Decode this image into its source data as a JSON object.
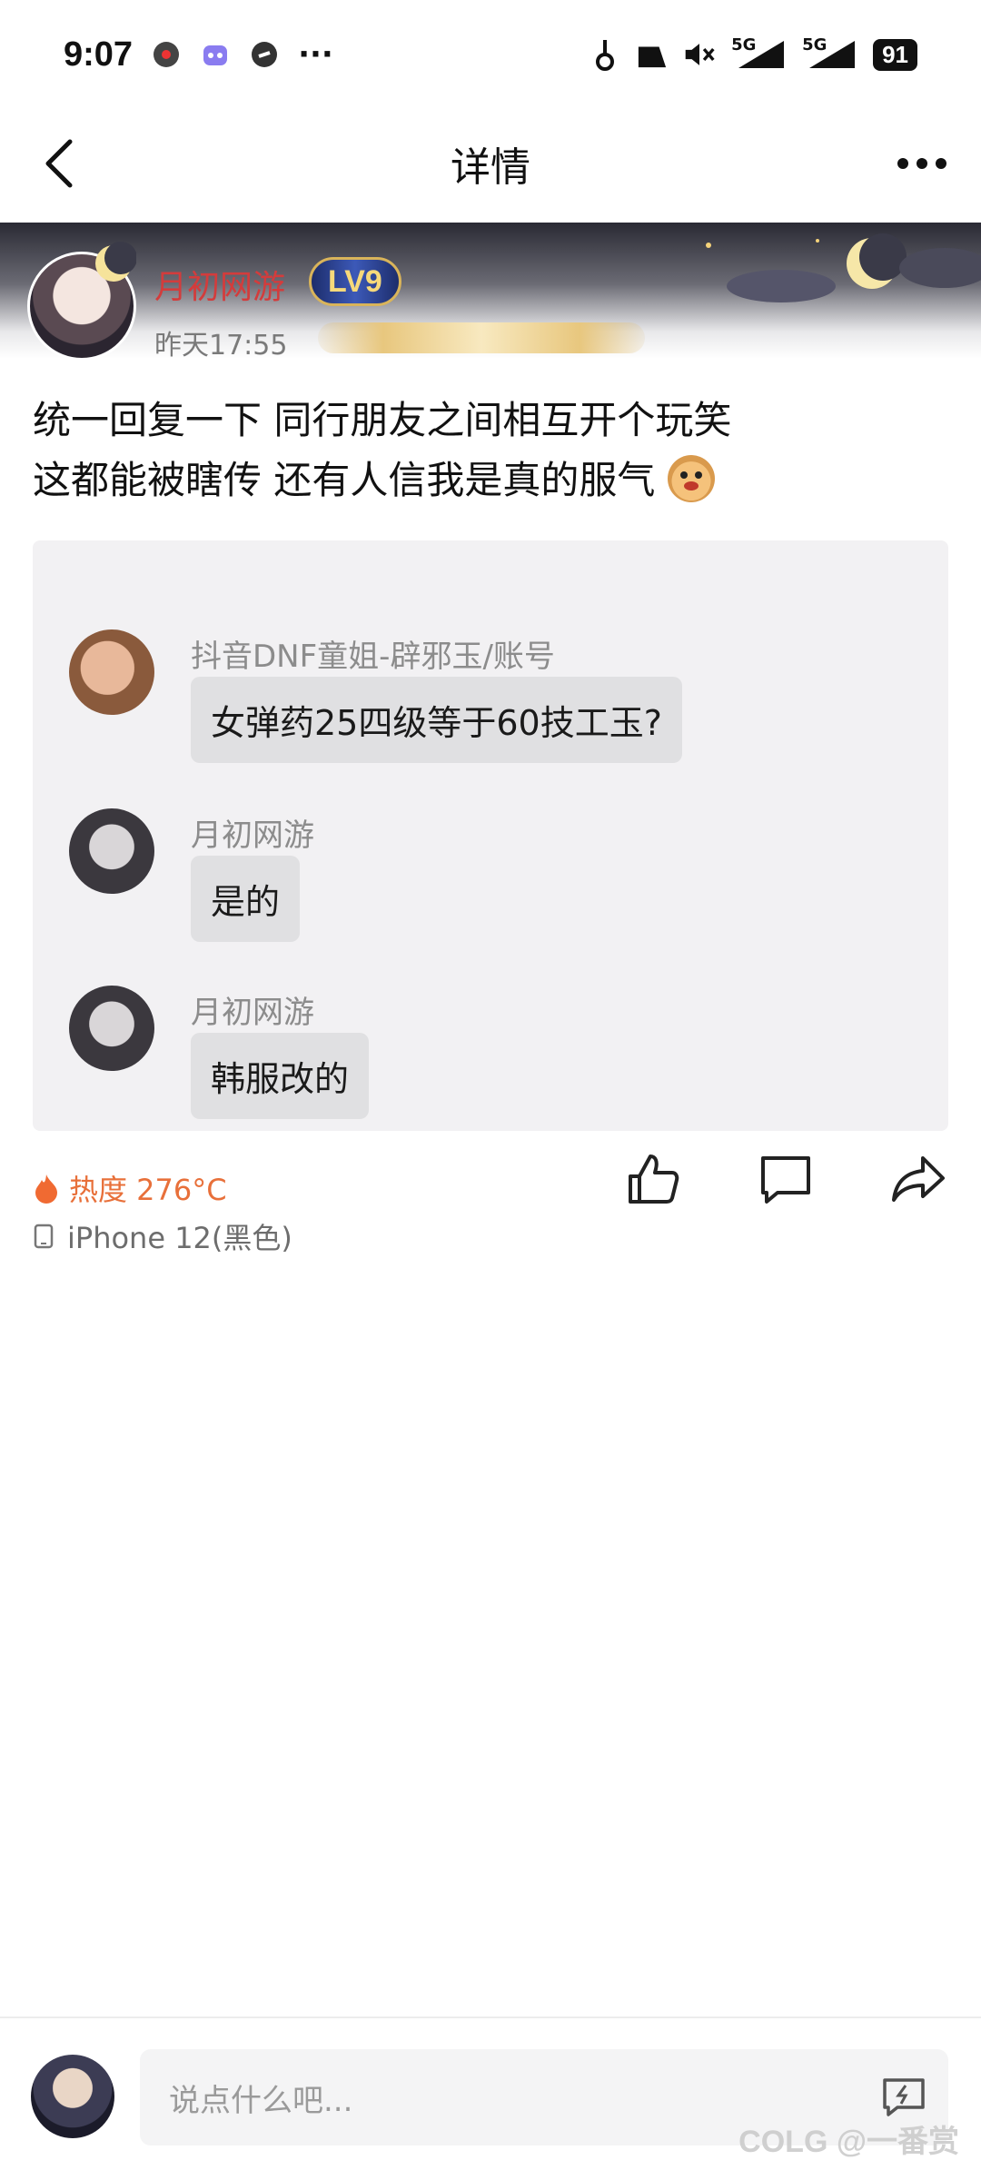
{
  "status_bar": {
    "time": "9:07",
    "battery": "91",
    "network_1": "5G",
    "network_2": "5G",
    "more": "···"
  },
  "nav": {
    "title": "详情",
    "back_icon": "chevron-left-icon",
    "more_icon": "more-icon"
  },
  "author": {
    "name": "月初网游",
    "level": "LV9",
    "time": "昨天17:55"
  },
  "post": {
    "line1": "统一回复一下 同行朋友之间相互开个玩笑",
    "line2": "这都能被瞎传 还有人信我是真的服气"
  },
  "chat": [
    {
      "sender": "抖音DNF童姐-辟邪玉/账号",
      "message": "女弹药25四级等于60技工玉?"
    },
    {
      "sender": "月初网游",
      "message": "是的"
    },
    {
      "sender": "月初网游",
      "message": "韩服改的"
    }
  ],
  "meta": {
    "heat": "热度 276°C",
    "device": "iPhone 12(黑色)"
  },
  "comment_bar": {
    "placeholder": "说点什么吧..."
  },
  "watermark": "COLG @一番赏",
  "colors": {
    "author_name": "#d33c3c",
    "heat": "#e8703a"
  }
}
